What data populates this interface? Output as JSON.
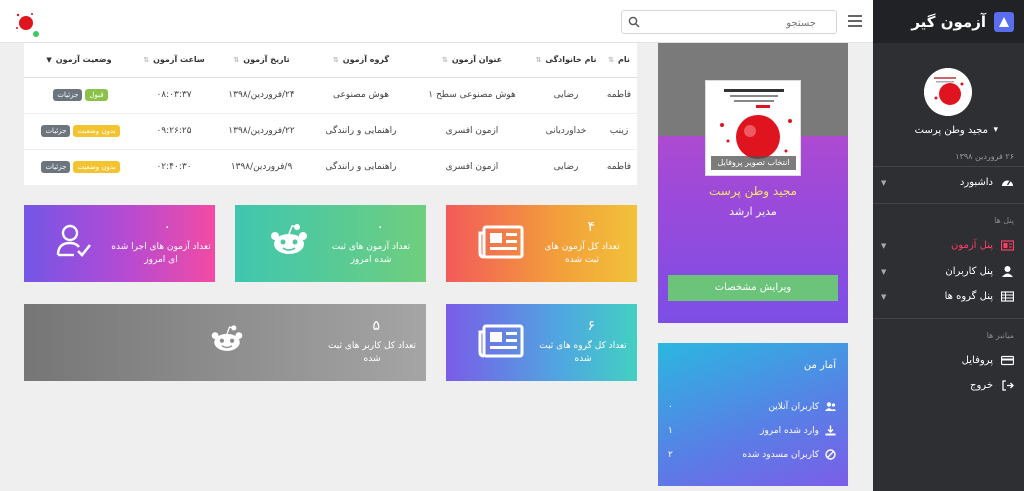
{
  "topbar": {
    "search_placeholder": "جستجو"
  },
  "sidebar": {
    "brand": "آزمون گیر",
    "profile_name": "مجید وطن پرست",
    "profile_date": "۲۶ فروردین ۱۳۹۸",
    "items": [
      {
        "label": "داشبورد",
        "icon": "dashboard-icon"
      },
      {
        "label": "پنل آزمون",
        "icon": "exam-panel-icon",
        "active": true
      },
      {
        "label": "پنل کاربران",
        "icon": "user-icon"
      },
      {
        "label": "پنل گروه ها",
        "icon": "table-icon"
      },
      {
        "label": "پروفایل",
        "icon": "card-icon"
      },
      {
        "label": "خروج",
        "icon": "logout-icon"
      }
    ],
    "section_panels": "پنل ها",
    "section_shortcuts": "میانبر ها"
  },
  "profile_card": {
    "image_caption": "انتخاب تصویر پروفایل",
    "name": "مجید وطن پرست",
    "role": "مدیر ارشد",
    "edit_button": "ویرایش مشخصات"
  },
  "stats": {
    "title": "آمار من",
    "rows": [
      {
        "label": "کاربران آنلاین",
        "value": "۰"
      },
      {
        "label": "وارد شده امروز",
        "value": "۱"
      },
      {
        "label": "کاربران مسدود شده",
        "value": "۲"
      }
    ]
  },
  "table": {
    "headers": [
      "نام",
      "نام خانوادگی",
      "عنوان آزمون",
      "گروه آزمون",
      "تاریخ آزمون",
      "ساعت آزمون",
      "وضعیت آزمون"
    ],
    "rows": [
      {
        "first": "فاطمه",
        "last": "رضایی",
        "title": "هوش مصنوعی سطح ۱",
        "group": "هوش مصنوعی",
        "date": "۲۴/فروردین/۱۳۹۸",
        "time": "۰۸:۰۳:۳۷",
        "status": "قبول",
        "status_type": "pass",
        "details": "جزئیات"
      },
      {
        "first": "زینب",
        "last": "خداوردیانی",
        "title": "ازمون افسری",
        "group": "راهنمایی و رانندگی",
        "date": "۲۲/فروردین/۱۳۹۸",
        "time": "۰۹:۲۶:۲۵",
        "status": "بدون وضعیت",
        "status_type": "nostatus",
        "details": "جزئیات"
      },
      {
        "first": "فاطمه",
        "last": "رضایی",
        "title": "ازمون افسری",
        "group": "راهنمایی و رانندگی",
        "date": "۹/فروردین/۱۳۹۸",
        "time": "۰۲:۴۰:۳۰",
        "status": "بدون وضعیت",
        "status_type": "nostatus",
        "details": "جزئیات"
      }
    ]
  },
  "tiles": [
    {
      "value": "۴",
      "label": "تعداد کل آزمون های ثبت شده",
      "icon": "newspaper-icon"
    },
    {
      "value": "۰",
      "label": "تعداد آزمون های ثبت شده امروز",
      "icon": "reddit-icon"
    },
    {
      "value": "۰",
      "label": "تعداد آزمون های اجرا شده ای امروز",
      "icon": "user-check-icon"
    },
    {
      "value": "۶",
      "label": "تعداد کل گروه های ثبت شده",
      "icon": "newspaper-icon"
    },
    {
      "value": "۵",
      "label": "تعداد کل کاربر های ثبت شده",
      "icon": "reddit-icon"
    }
  ],
  "colors": {
    "sidebar_bg": "#2e2f33",
    "active_item": "#ff3e67",
    "edit_button": "#6bc47a",
    "badge_pass": "#8bc34a",
    "badge_nostatus": "#f4c430",
    "badge_details": "#6c757d"
  }
}
